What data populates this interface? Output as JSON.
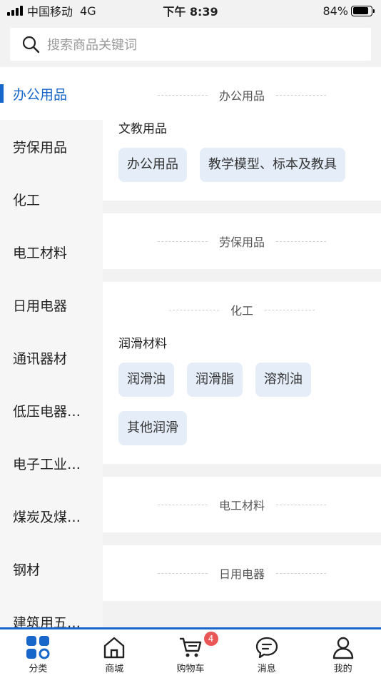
{
  "status_bar": {
    "carrier": "中国移动",
    "network": "4G",
    "time": "下午 8:39",
    "battery_percent_label": "84%",
    "battery_level": 0.84
  },
  "search": {
    "placeholder": "搜索商品关键词"
  },
  "sidebar": {
    "items": [
      {
        "label": "办公用品",
        "active": true
      },
      {
        "label": "劳保用品"
      },
      {
        "label": "化工"
      },
      {
        "label": "电工材料"
      },
      {
        "label": "日用电器"
      },
      {
        "label": "通讯器材"
      },
      {
        "label": "低压电器…"
      },
      {
        "label": "电子工业…"
      },
      {
        "label": "煤炭及煤…"
      },
      {
        "label": "钢材"
      },
      {
        "label": "建筑用五…"
      }
    ]
  },
  "content": {
    "sections": [
      {
        "title": "办公用品",
        "subcategories": [
          {
            "title": "文教用品",
            "chips": [
              "办公用品",
              "教学模型、标本及教具"
            ]
          }
        ]
      },
      {
        "title": "劳保用品",
        "subcategories": []
      },
      {
        "title": "化工",
        "subcategories": [
          {
            "title": "润滑材料",
            "chips": [
              "润滑油",
              "润滑脂",
              "溶剂油",
              "其他润滑"
            ]
          }
        ]
      },
      {
        "title": "电工材料",
        "subcategories": []
      },
      {
        "title": "日用电器",
        "subcategories": []
      }
    ]
  },
  "bottom_nav": {
    "items": [
      {
        "label": "分类",
        "icon": "category-icon",
        "active": true
      },
      {
        "label": "商城",
        "icon": "home-icon"
      },
      {
        "label": "购物车",
        "icon": "cart-icon",
        "badge": "4"
      },
      {
        "label": "消息",
        "icon": "message-icon"
      },
      {
        "label": "我的",
        "icon": "user-icon"
      }
    ]
  },
  "colors": {
    "accent": "#1766c9",
    "chip_bg": "#e4edf8",
    "badge": "#e85656"
  }
}
